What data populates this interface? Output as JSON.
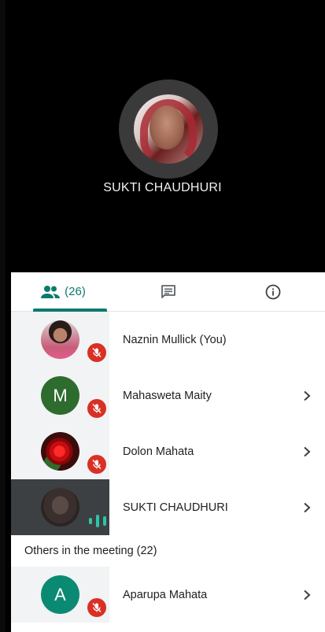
{
  "stage": {
    "active_speaker_name": "SUKTI CHAUDHURI"
  },
  "tabs": [
    {
      "id": "people",
      "icon": "people-icon",
      "count_label": "(26)",
      "active": true
    },
    {
      "id": "chat",
      "icon": "chat-icon",
      "active": false
    },
    {
      "id": "info",
      "icon": "info-icon",
      "active": false
    }
  ],
  "participants": [
    {
      "name": "Naznin Mullick (You)",
      "avatar": "photo",
      "status": "muted",
      "chevron": false
    },
    {
      "name": "Mahasweta Maity",
      "avatar": "letter",
      "avatar_letter": "M",
      "avatar_color": "#2e6b2f",
      "status": "muted",
      "chevron": true
    },
    {
      "name": "Dolon Mahata",
      "avatar": "photo",
      "status": "muted",
      "chevron": true
    },
    {
      "name": "SUKTI CHAUDHURI",
      "avatar": "photo",
      "status": "speaking",
      "chevron": true
    }
  ],
  "others_section": {
    "title": "Others in the meeting (22)"
  },
  "others": [
    {
      "name": "Aparupa Mahata",
      "avatar": "letter",
      "avatar_letter": "A",
      "avatar_color": "#0b8a73",
      "status": "muted",
      "chevron": true
    }
  ],
  "colors": {
    "accent": "#0b7a6d",
    "muted_badge": "#d93025",
    "speaking": "#2ec4a8"
  }
}
